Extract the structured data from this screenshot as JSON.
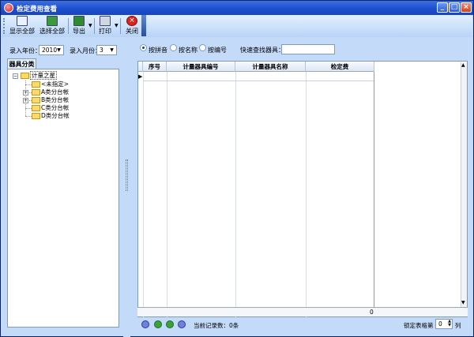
{
  "window": {
    "title": "检定费用查看"
  },
  "toolbar": {
    "show_all": "显示全部",
    "select_all": "选择全部",
    "export": "导出",
    "print": "打印",
    "close": "关闭"
  },
  "filters": {
    "year_label": "录入年份：",
    "year_value": "2010",
    "month_label": "录入月份：",
    "month_value": "3"
  },
  "tree": {
    "tab": "器具分类",
    "root": "计量之星",
    "nodes": [
      "<未指定>",
      "A类分台帐",
      "B类分台帐",
      "C类分台帐",
      "D类分台帐"
    ]
  },
  "search": {
    "opt_pinyin": "按拼音",
    "opt_name": "按名称",
    "opt_code": "按编号",
    "quick_label": "快速查找器具："
  },
  "grid": {
    "columns": [
      "序号",
      "计量器具编号",
      "计量器具名称",
      "检定费"
    ],
    "total": "0"
  },
  "status": {
    "record_label": "当前记录数：0条",
    "freeze_label": "锁定表格第",
    "freeze_value": "0",
    "freeze_unit": "列"
  },
  "colors": {
    "title_bar": "#1d4fcf",
    "panel_bg": "#c3daf9",
    "close_icon": "#d9261c"
  }
}
